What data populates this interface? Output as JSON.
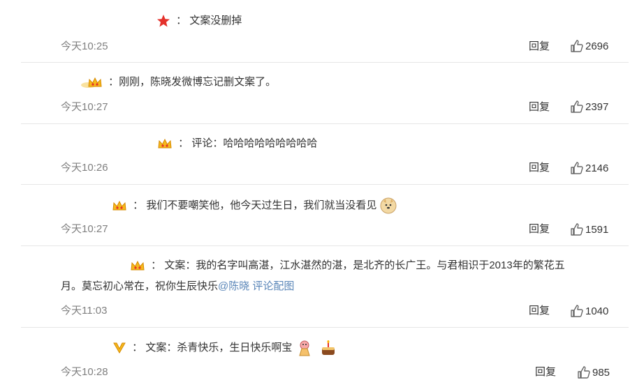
{
  "comments": [
    {
      "badge": "star-icon",
      "text": "：  文案没删掉",
      "time": "今天10:25",
      "reply": "回复",
      "likes": "2696"
    },
    {
      "badge": "crown-icon",
      "text": "：刚刚，陈晓发微博忘记删文案了。",
      "time": "今天10:27",
      "reply": "回复",
      "likes": "2397"
    },
    {
      "badge": "crown-icon",
      "text": "：  评论：哈哈哈哈哈哈哈哈哈",
      "time": "今天10:26",
      "reply": "回复",
      "likes": "2146"
    },
    {
      "badge": "crown-icon",
      "text": "：  我们不要嘲笑他，他今天过生日，我们就当没看见",
      "time": "今天10:27",
      "reply": "回复",
      "likes": "1591"
    },
    {
      "badge": "crown-icon",
      "text_line1": "：  文案：我的名字叫高湛，江水湛然的湛，是北齐的长广王。与君相识于2013年的繁花五",
      "text_line2": "月。莫忘初心常在，祝你生辰快乐",
      "mention": "@陈晓",
      "link": "评论配图",
      "time": "今天11:03",
      "reply": "回复",
      "likes": "1040"
    },
    {
      "badge": "v-icon",
      "text": "：  文案：杀青快乐，生日快乐啊宝",
      "time": "今天10:28",
      "reply": "回复",
      "likes": "985"
    }
  ]
}
